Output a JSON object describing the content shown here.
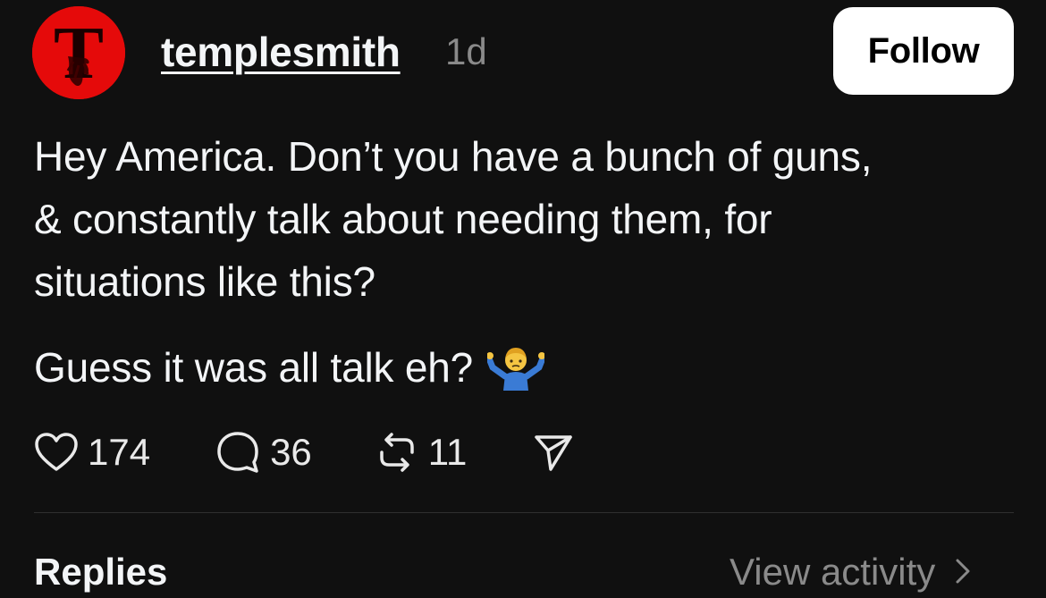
{
  "post": {
    "avatar_letter": "T",
    "username": "templesmith",
    "time": "1d",
    "follow_label": "Follow",
    "body_line1": "Hey America. Don’t you have a bunch of guns,",
    "body_line2": "& constantly talk about needing them, for",
    "body_line3": "situations like this?",
    "body_line4": "Guess it was all talk eh?",
    "emoji": "man-shrugging-emoji"
  },
  "actions": {
    "like_icon": "heart-icon",
    "like_count": "174",
    "comment_icon": "comment-icon",
    "comment_count": "36",
    "repost_icon": "repost-icon",
    "repost_count": "11",
    "share_icon": "send-icon"
  },
  "footer": {
    "replies_label": "Replies",
    "view_activity_label": "View activity"
  },
  "colors": {
    "background": "#101010",
    "text": "#f3f5f7",
    "secondary_text": "#8a8a8a",
    "avatar_bg": "#e50a0a",
    "follow_bg": "#ffffff"
  }
}
